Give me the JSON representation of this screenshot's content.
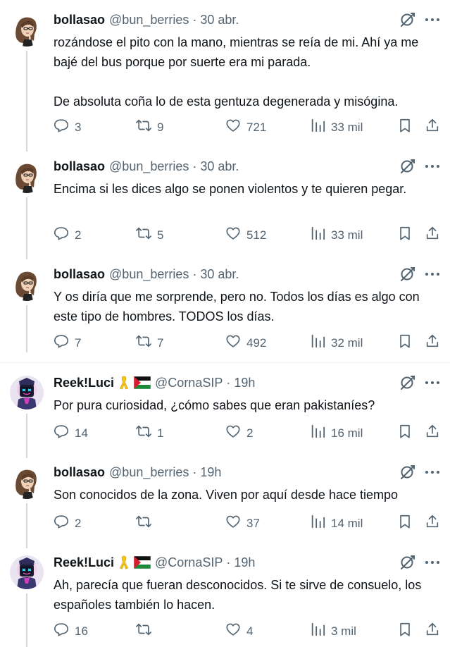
{
  "users": {
    "bollasao": {
      "name": "bollasao",
      "handle": "@bun_berries"
    },
    "reek": {
      "name": "Reek!Luci",
      "handle": "@CornaSIP"
    }
  },
  "tweets": [
    {
      "user": "bollasao",
      "time": "· 30 abr.",
      "text": "rozándose el pito con la mano, mientras se reía de mi. Ahí ya me bajé del bus porque por suerte era mi parada.\n\nDe absoluta coña lo de esta gentuza degenerada y misógina.",
      "replies": "3",
      "retweets": "9",
      "likes": "721",
      "views": "33 mil"
    },
    {
      "user": "bollasao",
      "time": "· 30 abr.",
      "text": "Encima si les dices algo se ponen violentos y te quieren pegar.",
      "replies": "2",
      "retweets": "5",
      "likes": "512",
      "views": "33 mil"
    },
    {
      "user": "bollasao",
      "time": "· 30 abr.",
      "text": "Y os diría que me sorprende, pero no. Todos los días es algo con este tipo de hombres. TODOS los días.",
      "replies": "7",
      "retweets": "7",
      "likes": "492",
      "views": "32 mil"
    },
    {
      "user": "reek",
      "time": "· 19h",
      "text": "Por pura curiosidad, ¿cómo sabes que eran pakistaníes?",
      "replies": "14",
      "retweets": "1",
      "likes": "2",
      "views": "16 mil"
    },
    {
      "user": "bollasao",
      "time": "· 19h",
      "text": "Son conocidos de la zona. Viven por aquí desde hace tiempo",
      "replies": "2",
      "retweets": "",
      "likes": "37",
      "views": "14 mil"
    },
    {
      "user": "reek",
      "time": "· 19h",
      "text": "Ah, parecía que fueran desconocidos. Si te sirve de consuelo, los españoles también lo hacen.",
      "replies": "16",
      "retweets": "",
      "likes": "4",
      "views": "3 mil"
    }
  ],
  "icons": [
    "grok-icon",
    "more-icon",
    "reply-icon",
    "retweet-icon",
    "like-icon",
    "views-icon",
    "bookmark-icon",
    "share-icon",
    "yellow-ribbon-icon",
    "palestine-flag-icon"
  ],
  "colors": {
    "text": "#0f1419",
    "secondary": "#536471",
    "thread_line": "#cfd9de",
    "divider": "#eff3f4"
  }
}
